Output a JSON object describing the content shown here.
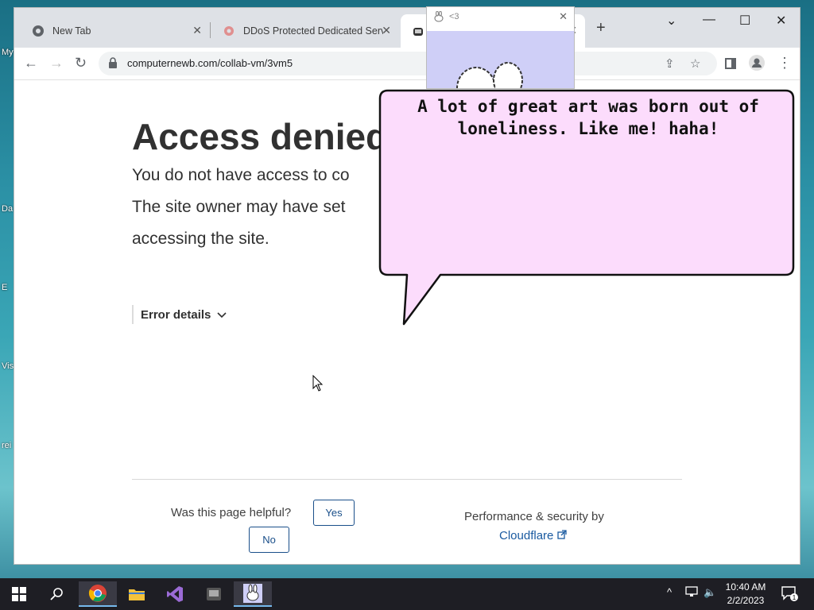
{
  "desktop": {
    "labels": [
      "My",
      "Da",
      "E",
      "Vis",
      "rei"
    ]
  },
  "browser": {
    "tabs": [
      {
        "title": "New Tab",
        "icon": "chrome-icon"
      },
      {
        "title": "DDoS Protected Dedicated Serve",
        "icon": "gear-icon"
      },
      {
        "title": "",
        "icon": "bunny-icon"
      }
    ],
    "new_tab_glyph": "+",
    "url": "computernewb.com/collab-vm/3vm5"
  },
  "popup": {
    "title": "<3"
  },
  "page": {
    "heading": "Access denied",
    "lead_line1": "You do not have access to co",
    "lead_line2": "The site owner may have set",
    "lead_line3": "accessing the site.",
    "error_details": "Error details",
    "helpful_question": "Was this page helpful?",
    "yes_label": "Yes",
    "no_label": "No",
    "perf_text": "Performance & security by",
    "cloudflare_label": "Cloudflare"
  },
  "bubble": {
    "line1": "A lot of great art was born out of",
    "line2": "loneliness. Like me! haha!",
    "fill": "#fcdcfc"
  },
  "taskbar": {
    "time": "10:40 AM",
    "date": "2/2/2023",
    "notifications": "1"
  }
}
